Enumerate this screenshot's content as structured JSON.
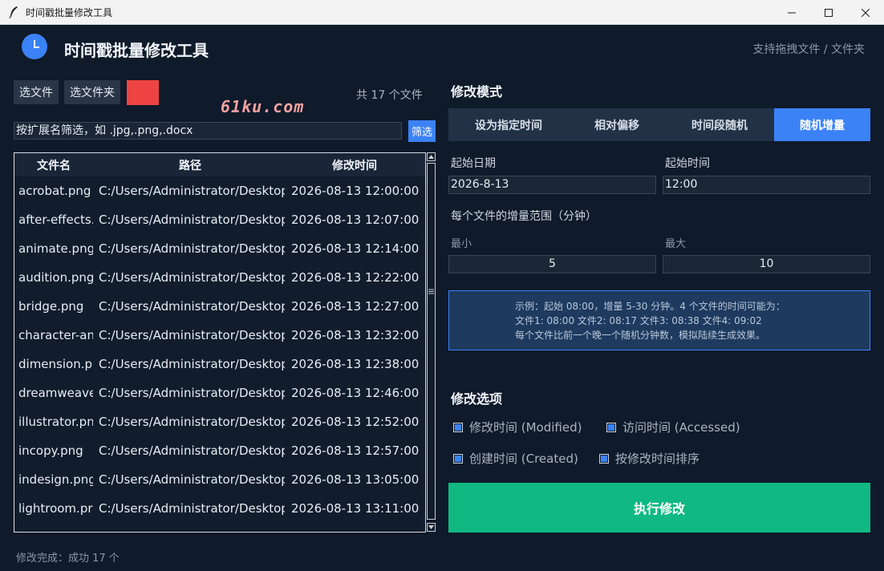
{
  "window": {
    "title": "时间戳批量修改工具"
  },
  "header": {
    "title": "时间戳批量修改工具",
    "drag_hint": "支持拖拽文件 / 文件夹"
  },
  "toolbar": {
    "select_file": "选文件",
    "select_folder": "选文件夹",
    "file_count": "共 17 个文件",
    "watermark": "61ku.com",
    "swatch_color": "#ef4444"
  },
  "filter": {
    "placeholder": "按扩展名筛选，如 .jpg,.png,.docx",
    "button": "筛选"
  },
  "table": {
    "columns": [
      "文件名",
      "路径",
      "修改时间"
    ],
    "rows": [
      [
        "acrobat.png",
        "C:/Users/Administrator/Desktop",
        "2026-08-13 12:00:00"
      ],
      [
        "after-effects.",
        "C:/Users/Administrator/Desktop",
        "2026-08-13 12:07:00"
      ],
      [
        "animate.png",
        "C:/Users/Administrator/Desktop",
        "2026-08-13 12:14:00"
      ],
      [
        "audition.png",
        "C:/Users/Administrator/Desktop",
        "2026-08-13 12:22:00"
      ],
      [
        "bridge.png",
        "C:/Users/Administrator/Desktop",
        "2026-08-13 12:27:00"
      ],
      [
        "character-an",
        "C:/Users/Administrator/Desktop",
        "2026-08-13 12:32:00"
      ],
      [
        "dimension.p",
        "C:/Users/Administrator/Desktop",
        "2026-08-13 12:38:00"
      ],
      [
        "dreamweave",
        "C:/Users/Administrator/Desktop",
        "2026-08-13 12:46:00"
      ],
      [
        "illustrator.pn",
        "C:/Users/Administrator/Desktop",
        "2026-08-13 12:52:00"
      ],
      [
        "incopy.png",
        "C:/Users/Administrator/Desktop",
        "2026-08-13 12:57:00"
      ],
      [
        "indesign.png",
        "C:/Users/Administrator/Desktop",
        "2026-08-13 13:05:00"
      ],
      [
        "lightroom.pr",
        "C:/Users/Administrator/Desktop",
        "2026-08-13 13:11:00"
      ]
    ]
  },
  "status": "修改完成：成功 17 个",
  "mode": {
    "title": "修改模式",
    "tabs": [
      "设为指定时间",
      "相对偏移",
      "时间段随机",
      "随机增量"
    ],
    "active_tab": 3,
    "start_date_label": "起始日期",
    "start_date": "2026-8-13",
    "start_time_label": "起始时间",
    "start_time": "12:00",
    "range_label": "每个文件的增量范围（分钟）",
    "min_label": "最小",
    "min": "5",
    "max_label": "最大",
    "max": "10",
    "example_lines": [
      "示例：起始 08:00，增量 5-30 分钟。4 个文件的时间可能为：",
      "文件1: 08:00  文件2: 08:17  文件3: 08:38  文件4: 09:02",
      "每个文件比前一个晚一个随机分钟数，模拟陆续生成效果。"
    ]
  },
  "options": {
    "title": "修改选项",
    "modified": "修改时间 (Modified)",
    "accessed": "访问时间 (Accessed)",
    "created": "创建时间 (Created)",
    "sort": "按修改时间排序"
  },
  "execute": "执行修改",
  "colors": {
    "accent": "#3b82f6",
    "execute": "#10b981",
    "background": "#0f1a2a"
  }
}
